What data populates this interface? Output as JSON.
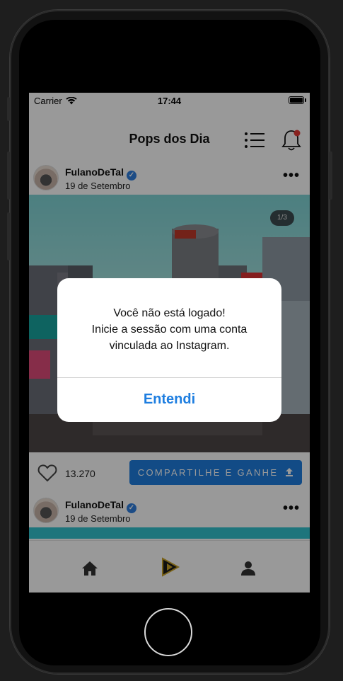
{
  "status_bar": {
    "carrier": "Carrier",
    "time": "17:44"
  },
  "header": {
    "title": "Pops dos Dia",
    "menu_icon": "list-icon",
    "bell_icon": "bell-icon",
    "notification_color": "#e53935"
  },
  "posts": [
    {
      "username": "FulanoDeTal",
      "date": "19 de Setembro",
      "image_counter": "1/3",
      "likes": "13.270",
      "share_label": "COMPARTILHE E GANHE"
    },
    {
      "username": "FulanoDeTal",
      "date": "19 de Setembro"
    }
  ],
  "tabbar": {
    "items": [
      {
        "icon": "home-icon"
      },
      {
        "icon": "app-logo-icon"
      },
      {
        "icon": "user-icon"
      }
    ]
  },
  "dialog": {
    "line1": "Você não está logado!",
    "line2": "Inicie a sessão com uma conta",
    "line3": "vinculada ao Instagram.",
    "button_label": "Entendi"
  },
  "colors": {
    "accent": "#1e7ee0",
    "verified": "#2f7fe0"
  }
}
